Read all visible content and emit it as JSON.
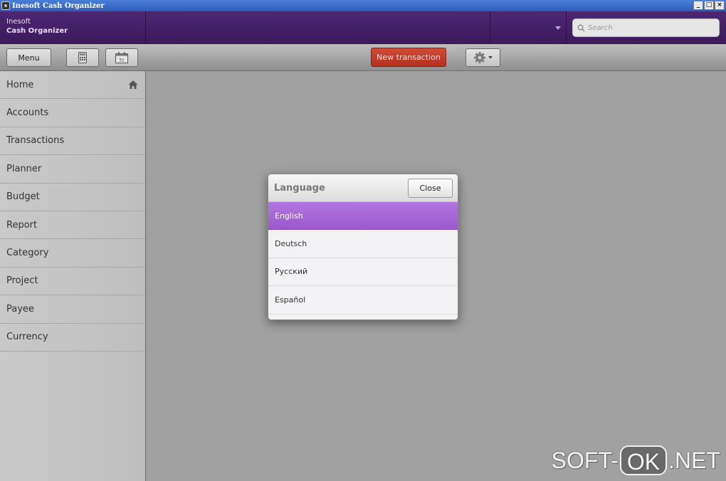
{
  "window": {
    "title": "Inesoft Cash Organizer",
    "controls": {
      "minimize": "_",
      "maximize": "□",
      "close": "×"
    }
  },
  "header": {
    "brand_line1": "Inesoft",
    "brand_line2": "Cash Organizer",
    "search": {
      "placeholder": "Search",
      "value": ""
    }
  },
  "toolbar": {
    "menu_label": "Menu",
    "new_transaction_label": "New transaction"
  },
  "sidebar": {
    "items": [
      {
        "label": "Home"
      },
      {
        "label": "Accounts"
      },
      {
        "label": "Transactions"
      },
      {
        "label": "Planner"
      },
      {
        "label": "Budget"
      },
      {
        "label": "Report"
      },
      {
        "label": "Category"
      },
      {
        "label": "Project"
      },
      {
        "label": "Payee"
      },
      {
        "label": "Currency"
      }
    ]
  },
  "dialog": {
    "title": "Language",
    "close_label": "Close",
    "languages": [
      {
        "label": "English",
        "selected": true
      },
      {
        "label": "Deutsch",
        "selected": false
      },
      {
        "label": "Русский",
        "selected": false
      },
      {
        "label": "Español",
        "selected": false
      }
    ]
  },
  "watermark": {
    "left": "SOFT-",
    "mid": "OK",
    "right": ".NET"
  },
  "colors": {
    "header_purple": "#4e2672",
    "accent_red": "#c23d2b",
    "selected_purple": "#a766d8"
  }
}
